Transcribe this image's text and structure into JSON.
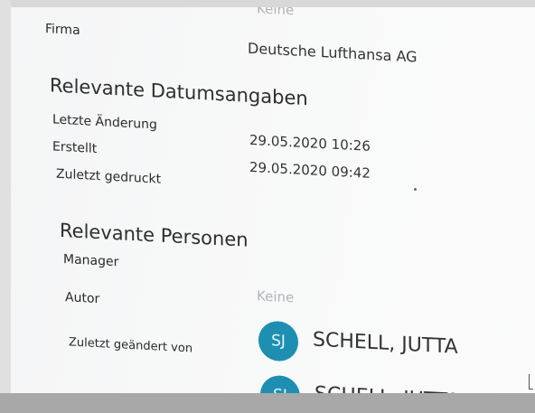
{
  "top_value": "Keine",
  "company": {
    "label": "Firma",
    "value": "Deutsche Lufthansa AG"
  },
  "dates": {
    "heading": "Relevante Datumsangaben",
    "last_modified_label": "Letzte Änderung",
    "last_modified_value": "29.05.2020 10:26",
    "created_label": "Erstellt",
    "created_value": "29.05.2020 09:42",
    "last_printed_label": "Zuletzt gedruckt"
  },
  "people": {
    "heading": "Relevante Personen",
    "manager_label": "Manager",
    "author_label": "Autor",
    "author_value": "Keine",
    "author_person": {
      "initials": "SJ",
      "name": "SCHELL, JUTTA"
    },
    "modified_by_label": "Zuletzt geändert von",
    "modified_by_person": {
      "initials": "SJ",
      "name": "SCHELL, JUTTA"
    }
  },
  "colors": {
    "avatar": "#1e8fb0"
  }
}
